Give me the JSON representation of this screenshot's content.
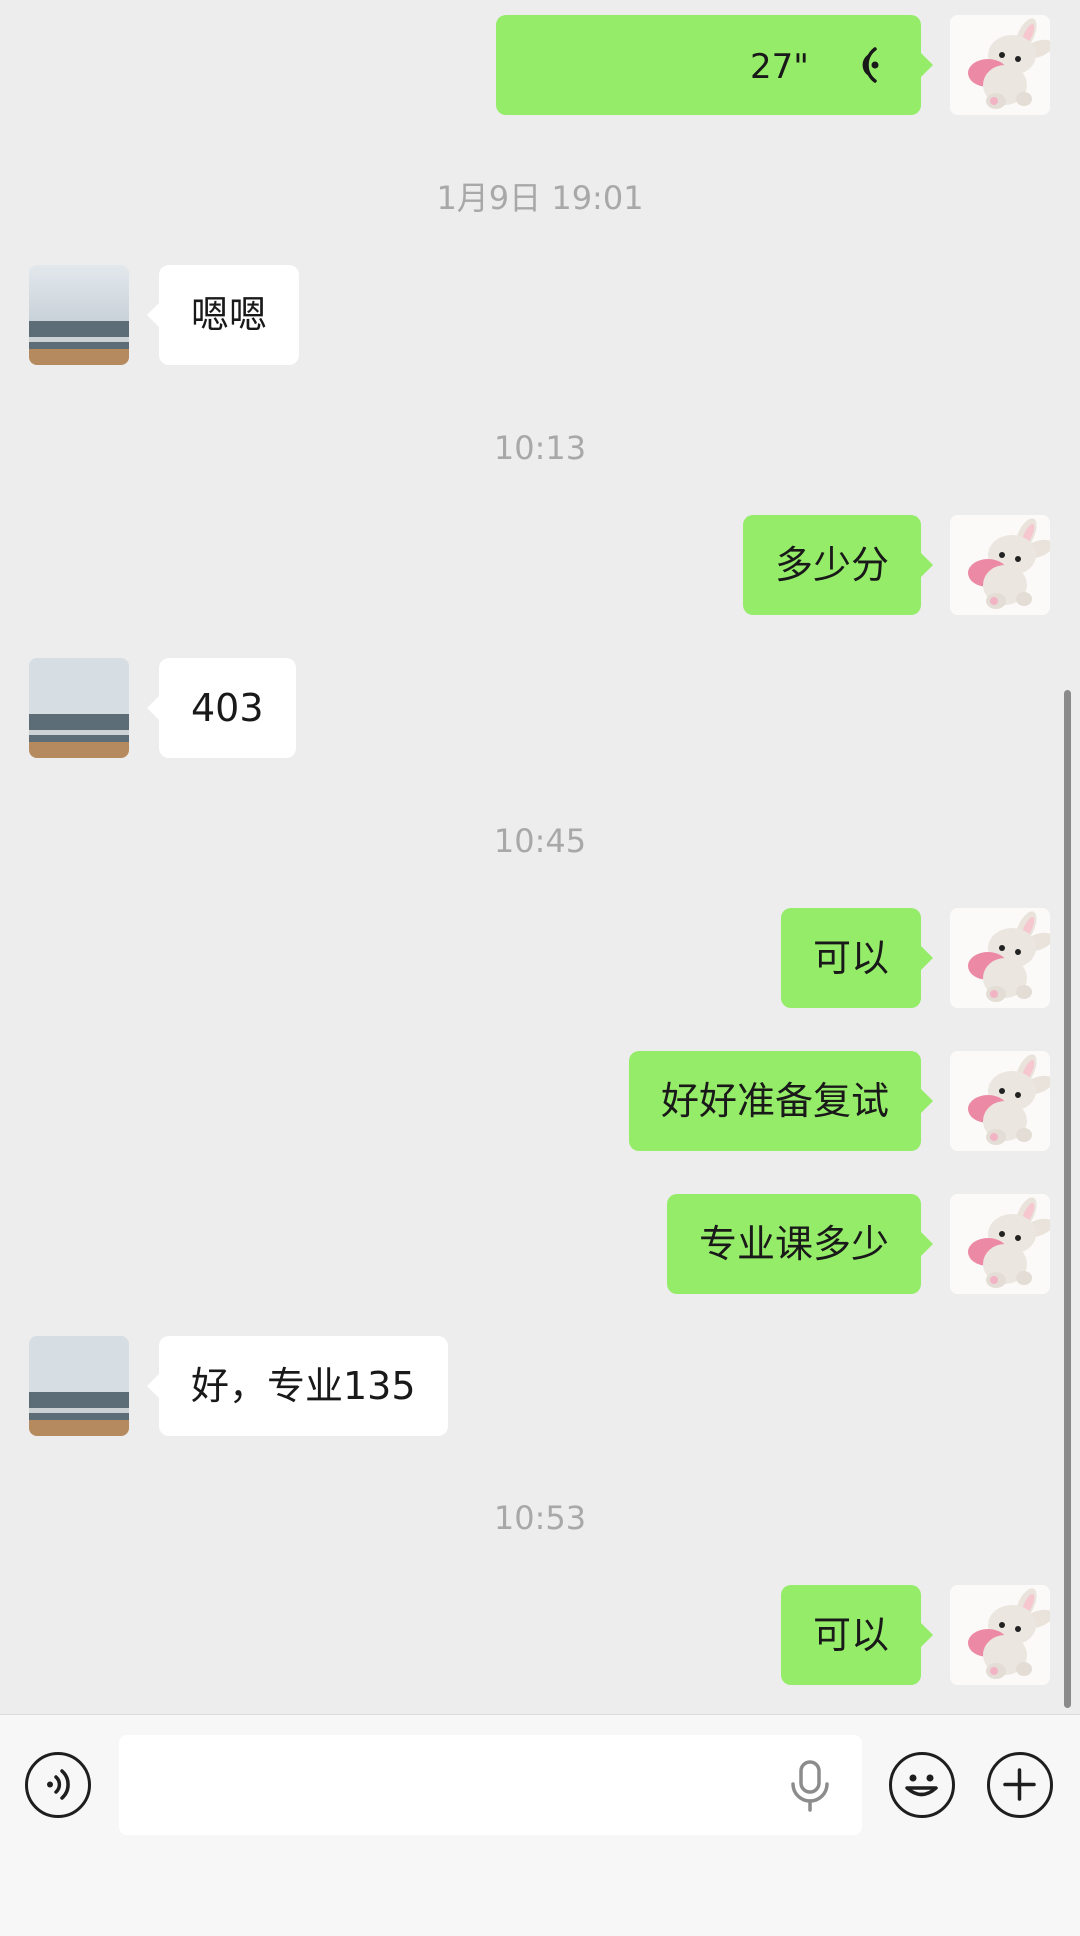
{
  "messages": [
    {
      "id": "m1",
      "side": "right",
      "type": "voice",
      "duration": "27\""
    },
    {
      "id": "t1",
      "type": "timestamp",
      "text": "1月9日 19:01"
    },
    {
      "id": "m2",
      "side": "left",
      "type": "text",
      "text": "嗯嗯"
    },
    {
      "id": "t2",
      "type": "timestamp",
      "text": "10:13"
    },
    {
      "id": "m3",
      "side": "right",
      "type": "text",
      "text": "多少分"
    },
    {
      "id": "m4",
      "side": "left",
      "type": "text",
      "text": "403"
    },
    {
      "id": "t3",
      "type": "timestamp",
      "text": "10:45"
    },
    {
      "id": "m5",
      "side": "right",
      "type": "text",
      "text": "可以"
    },
    {
      "id": "m6",
      "side": "right",
      "type": "text",
      "text": "好好准备复试"
    },
    {
      "id": "m7",
      "side": "right",
      "type": "text",
      "text": "专业课多少"
    },
    {
      "id": "m8",
      "side": "left",
      "type": "text",
      "text": "好，专业135"
    },
    {
      "id": "t4",
      "type": "timestamp",
      "text": "10:53"
    },
    {
      "id": "m9",
      "side": "right",
      "type": "text",
      "text": "可以"
    }
  ],
  "input_bar": {
    "text_value": "",
    "icons": [
      "voice-toggle-icon",
      "microphone-icon",
      "emoji-icon",
      "plus-icon"
    ]
  },
  "colors": {
    "background": "#ededed",
    "sent_bubble": "#95ec69",
    "received_bubble": "#ffffff",
    "timestamp_text": "#a8a8a8"
  }
}
